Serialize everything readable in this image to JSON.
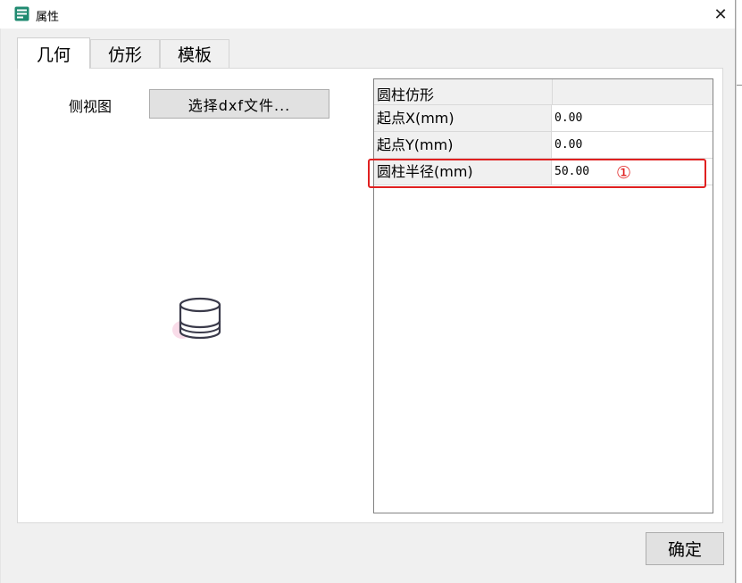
{
  "window": {
    "title": "属性",
    "icon": "properties-app-icon"
  },
  "tabs": [
    {
      "label": "几何",
      "active": true
    },
    {
      "label": "仿形",
      "active": false
    },
    {
      "label": "模板",
      "active": false
    }
  ],
  "geometry": {
    "side_view_label": "侧视图",
    "select_button": "选择dxf文件..."
  },
  "property_grid": {
    "category": "圆柱仿形",
    "rows": [
      {
        "name": "起点X(mm)",
        "value": "0.00"
      },
      {
        "name": "起点Y(mm)",
        "value": "0.00"
      },
      {
        "name": "圆柱半径(mm)",
        "value": "50.00"
      }
    ]
  },
  "annotation": {
    "marker": "①",
    "color": "#e02020"
  },
  "footer": {
    "ok_button": "确定"
  }
}
